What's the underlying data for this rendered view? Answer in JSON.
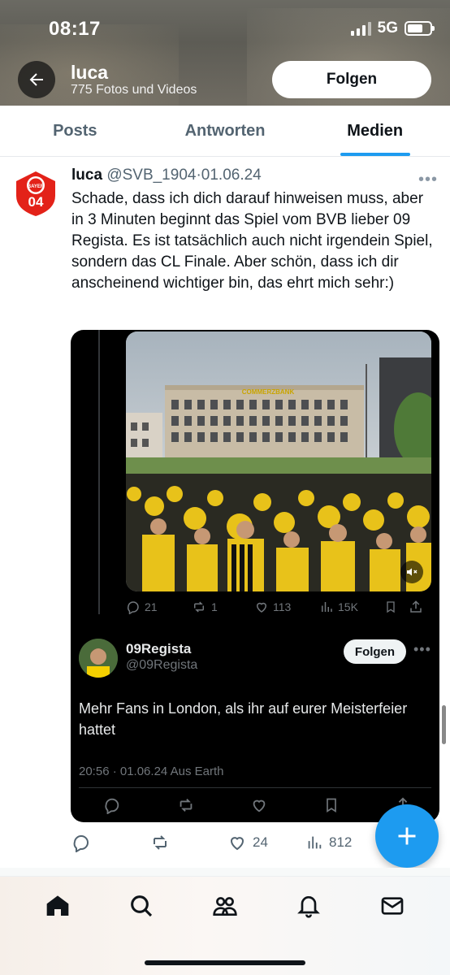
{
  "status_bar": {
    "time": "08:17",
    "network": "5G"
  },
  "header": {
    "profile_name": "luca",
    "profile_subtitle": "775 Fotos und Videos",
    "follow_label": "Folgen"
  },
  "tabs": [
    {
      "label": "Posts",
      "active": false
    },
    {
      "label": "Antworten",
      "active": false
    },
    {
      "label": "Medien",
      "active": true
    }
  ],
  "tweet": {
    "author_name": "luca",
    "author_handle": "@SVB_1904",
    "date": "01.06.24",
    "avatar_text": "BAYER 04",
    "text": "Schade, dass ich dich darauf hinweisen muss, aber in 3 Minuten beginnt das Spiel vom BVB lieber 09 Regista. Es ist tatsächlich auch nicht irgendein Spiel, sondern das CL Finale. Aber schön, dass ich dir anscheinend wichtiger bin, das ehrt mich sehr:)",
    "actions": {
      "replies": "",
      "reposts": "",
      "likes": "24",
      "views": "812"
    }
  },
  "quoted": {
    "video_sign": "COMMERZBANK",
    "video_stats": {
      "replies": "21",
      "reposts": "1",
      "likes": "113",
      "views": "15K"
    },
    "author_name": "09Regista",
    "author_handle": "@09Regista",
    "follow_label": "Folgen",
    "text": "Mehr Fans in London, als ihr auf eurer Meisterfeier hattet",
    "meta": "20:56 · 01.06.24 Aus Earth"
  },
  "colors": {
    "accent": "#1d9bf0",
    "bvb_yellow": "#f5d000"
  },
  "icons": [
    "back-arrow-icon",
    "reply-icon",
    "repost-icon",
    "like-icon",
    "views-icon",
    "bookmark-icon",
    "share-icon",
    "mute-icon",
    "plus-icon",
    "home-icon",
    "search-icon",
    "communities-icon",
    "notifications-icon",
    "messages-icon"
  ]
}
